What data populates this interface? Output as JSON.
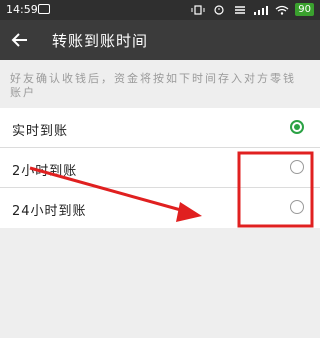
{
  "status_bar": {
    "time": "14:59",
    "battery": "90"
  },
  "header": {
    "title": "转账到账时间"
  },
  "description": "好友确认收钱后，资金将按如下时间存入对方零钱账户",
  "options": [
    {
      "label": "实时到账",
      "selected": true
    },
    {
      "label": "2小时到账",
      "selected": false
    },
    {
      "label": "24小时到账",
      "selected": false
    }
  ],
  "colors": {
    "accent": "#2ba245",
    "annotation": "#e02020"
  }
}
